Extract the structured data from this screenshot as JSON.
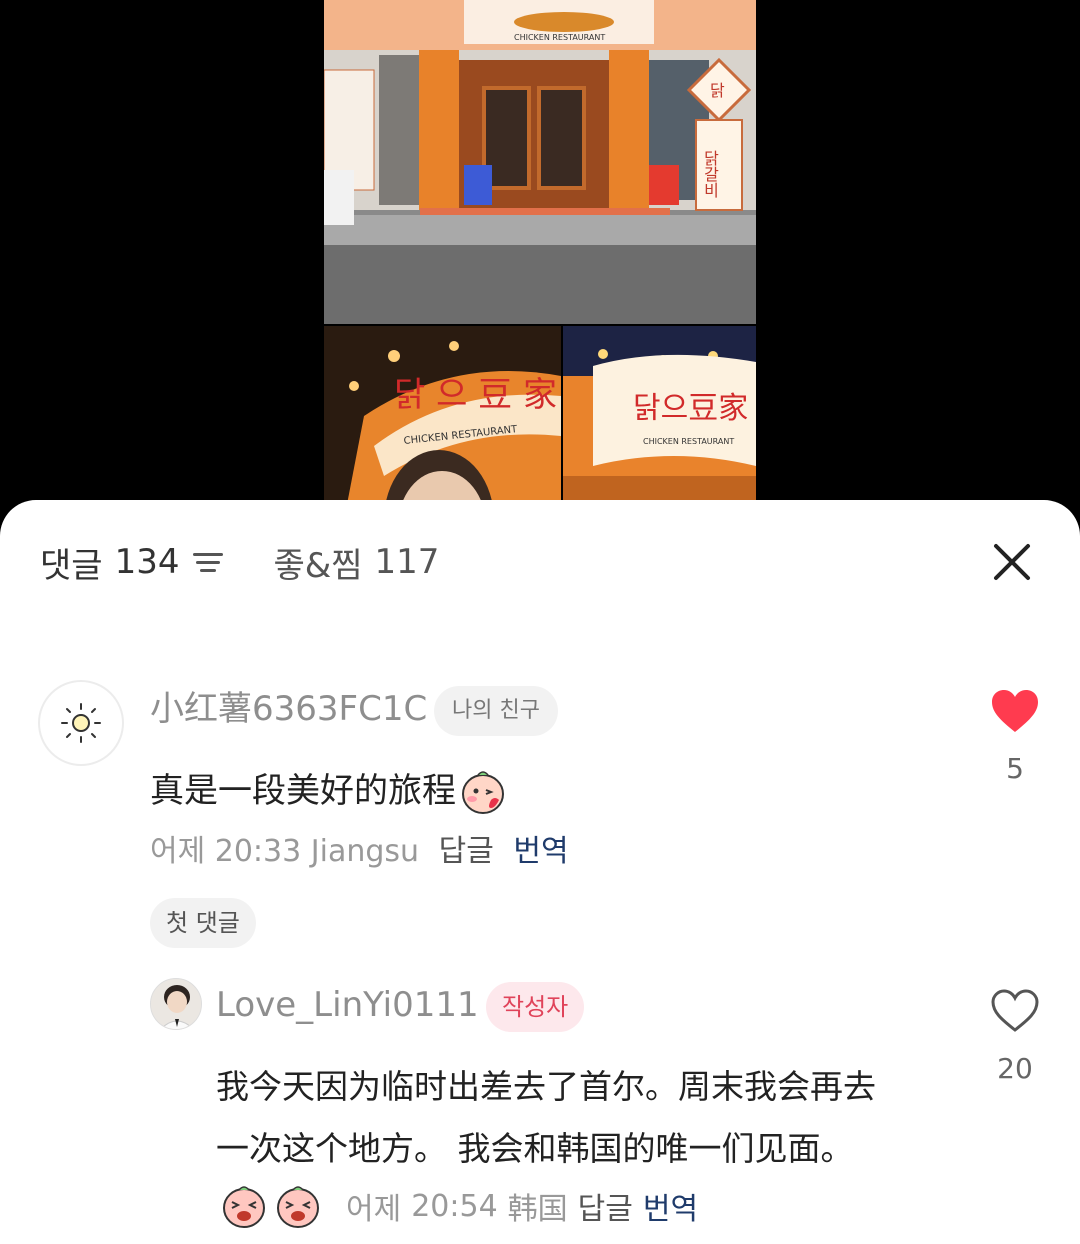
{
  "photos": {
    "top_sign_text": "CHICKEN RESTAURANT",
    "side_sign_top": "닭",
    "side_sign_vertical": "닭갈비",
    "bottom_sign_text": "CHICKEN RESTAURANT"
  },
  "sheet": {
    "tabs": {
      "comments_label": "댓글",
      "comments_count": "134",
      "likes_label": "좋&찜",
      "likes_count": "117"
    },
    "close_icon": "close-icon"
  },
  "comments": [
    {
      "username": "小红薯6363FC1C",
      "tag": "나의 친구",
      "text": "真是一段美好的旅程",
      "date": "어제",
      "time": "20:33",
      "location": "Jiangsu",
      "reply_label": "답글",
      "translate_label": "번역",
      "like_count": "5",
      "liked": true,
      "first_comment_badge": "첫 댓글"
    },
    {
      "username": "Love_LinYi0111",
      "tag": "작성자",
      "text_line1": "我今天因为临时出差去了首尔。周末我会再去",
      "text_line2": "一次这个地方。 我会和韩国的唯一们见面。",
      "date": "어제",
      "time": "20:54",
      "location": "韩国",
      "reply_label": "답글",
      "translate_label": "번역",
      "like_count": "20",
      "liked": false
    }
  ],
  "colors": {
    "liked_heart": "#ff3b4f",
    "author_tag_bg": "#fde8ec",
    "author_tag_text": "#e0435a",
    "translate_link": "#1f3b6b"
  }
}
